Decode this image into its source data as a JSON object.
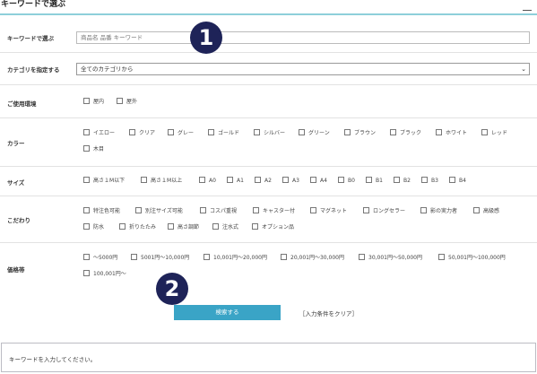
{
  "header": {
    "title": "キーワードで選ぶ"
  },
  "keyword": {
    "label": "キーワードで選ぶ",
    "placeholder": "商品名 品番 キーワード"
  },
  "category": {
    "label": "カテゴリを指定する",
    "selected": "全てのカテゴリから"
  },
  "environment": {
    "label": "ご使用環境",
    "options": [
      "屋内",
      "屋外"
    ]
  },
  "color": {
    "label": "カラー",
    "options": [
      "イエロー",
      "クリア",
      "グレー",
      "ゴールド",
      "シルバー",
      "グリーン",
      "ブラウン",
      "ブラック",
      "ホワイト",
      "レッド",
      "木目"
    ]
  },
  "size": {
    "label": "サイズ",
    "options": [
      "高さ１M以下",
      "高さ１M以上",
      "A0",
      "A1",
      "A2",
      "A3",
      "A4",
      "B0",
      "B1",
      "B2",
      "B3",
      "B4"
    ]
  },
  "features": {
    "label": "こだわり",
    "options": [
      "特注色可能",
      "別注サイズ可能",
      "コスパ重視",
      "キャスター付",
      "マグネット",
      "ロングセラー",
      "影の実力者",
      "高級感",
      "防水",
      "折りたたみ",
      "高さ調節",
      "注水式",
      "オプション品"
    ]
  },
  "price": {
    "label": "価格帯",
    "options": [
      "～5000円",
      "5001円～10,000円",
      "10,001円～20,000円",
      "20,001円～30,000円",
      "30,001円～50,000円",
      "50,001円～100,000円",
      "100,001円～"
    ]
  },
  "badges": {
    "one": "1",
    "two": "2"
  },
  "actions": {
    "search": "検索する",
    "clear": "［入力条件をクリア］"
  },
  "message": "キーワードを入力してください。"
}
